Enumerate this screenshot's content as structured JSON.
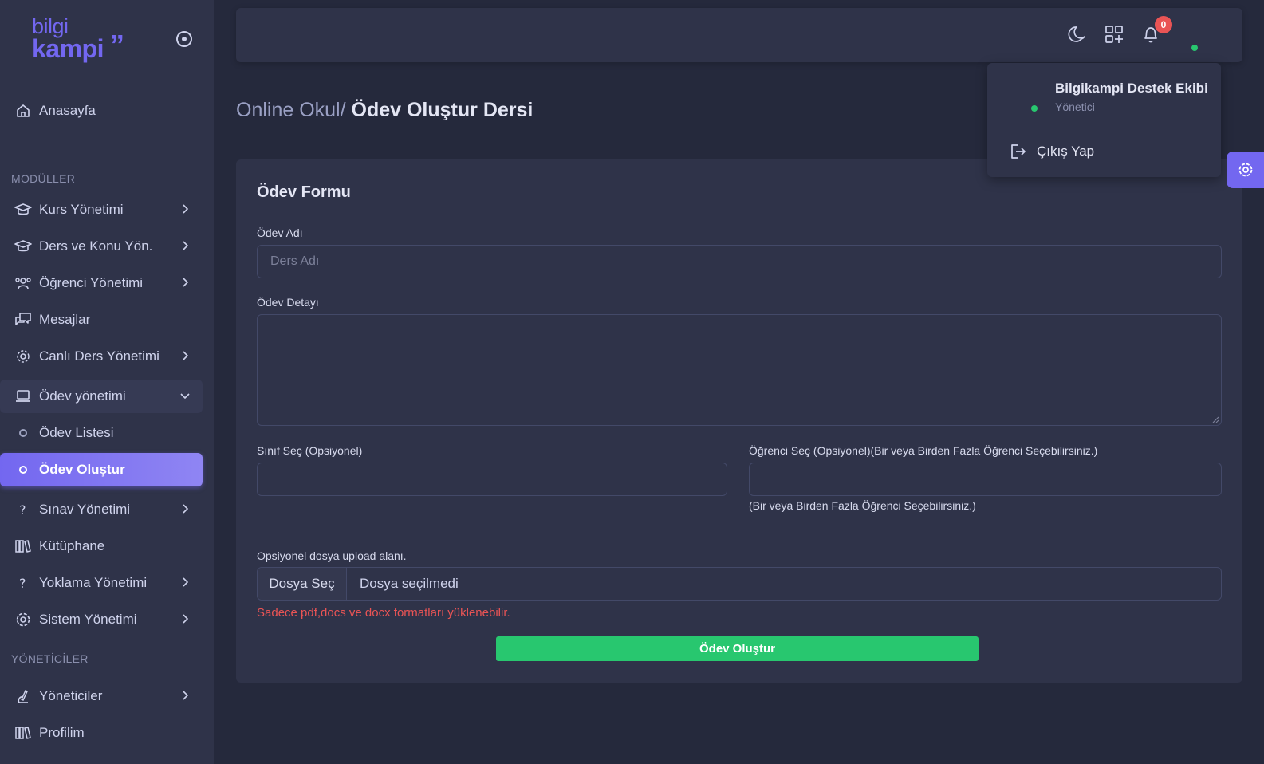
{
  "brand": {
    "line1": "bilgi",
    "line2": "kampi"
  },
  "sidebar": {
    "home": "Anasayfa",
    "section_modules": "MODÜLLER",
    "items": [
      {
        "label": "Kurs Yönetimi",
        "icon": "graduation-cap-icon"
      },
      {
        "label": "Ders ve Konu Yön.",
        "icon": "graduation-cap-icon"
      },
      {
        "label": "Öğrenci Yönetimi",
        "icon": "users-icon"
      },
      {
        "label": "Mesajlar",
        "icon": "messages-icon"
      },
      {
        "label": "Canlı Ders Yönetimi",
        "icon": "broadcast-icon"
      },
      {
        "label": "Ödev yönetimi",
        "icon": "laptop-icon"
      },
      {
        "label": "Ödev Listesi",
        "icon": "circle-icon"
      },
      {
        "label": "Ödev Oluştur",
        "icon": "circle-icon"
      },
      {
        "label": "Sınav Yönetimi",
        "icon": "question-icon"
      },
      {
        "label": "Kütüphane",
        "icon": "books-icon"
      },
      {
        "label": "Yoklama Yönetimi",
        "icon": "question-icon"
      },
      {
        "label": "Sistem Yönetimi",
        "icon": "gear-icon"
      }
    ],
    "section_admins": "YÖNETİCİLER",
    "admin_items": [
      {
        "label": "Yöneticiler",
        "icon": "microscope-icon"
      },
      {
        "label": "Profilim",
        "icon": "books-icon"
      }
    ]
  },
  "navbar": {
    "notifications_count": "0"
  },
  "breadcrumb": {
    "parent": "Online Okul/",
    "current": "Ödev Oluştur Dersi"
  },
  "form": {
    "title": "Ödev Formu",
    "name_label": "Ödev Adı",
    "name_placeholder": "Ders Adı",
    "detail_label": "Ödev Detayı",
    "class_label": "Sınıf Seç (Opsiyonel)",
    "student_label": "Öğrenci Seç (Opsiyonel)(Bir veya Birden Fazla Öğrenci Seçebilirsiniz.)",
    "student_hint": "(Bir veya Birden Fazla Öğrenci Seçebilirsiniz.)",
    "upload_label": "Opsiyonel dosya upload alanı.",
    "file_button": "Dosya Seç",
    "file_status": "Dosya seçilmedi",
    "file_error": "Sadece pdf,docs ve docx formatları yüklenebilir.",
    "submit": "Ödev Oluştur"
  },
  "user_menu": {
    "name": "Bilgikampi Destek Ekibi",
    "role": "Yönetici",
    "logout": "Çıkış Yap"
  },
  "colors": {
    "accent": "#7367f0",
    "success": "#28c76f",
    "danger": "#ea5455",
    "background": "#25293c",
    "surface": "#2f3349"
  }
}
